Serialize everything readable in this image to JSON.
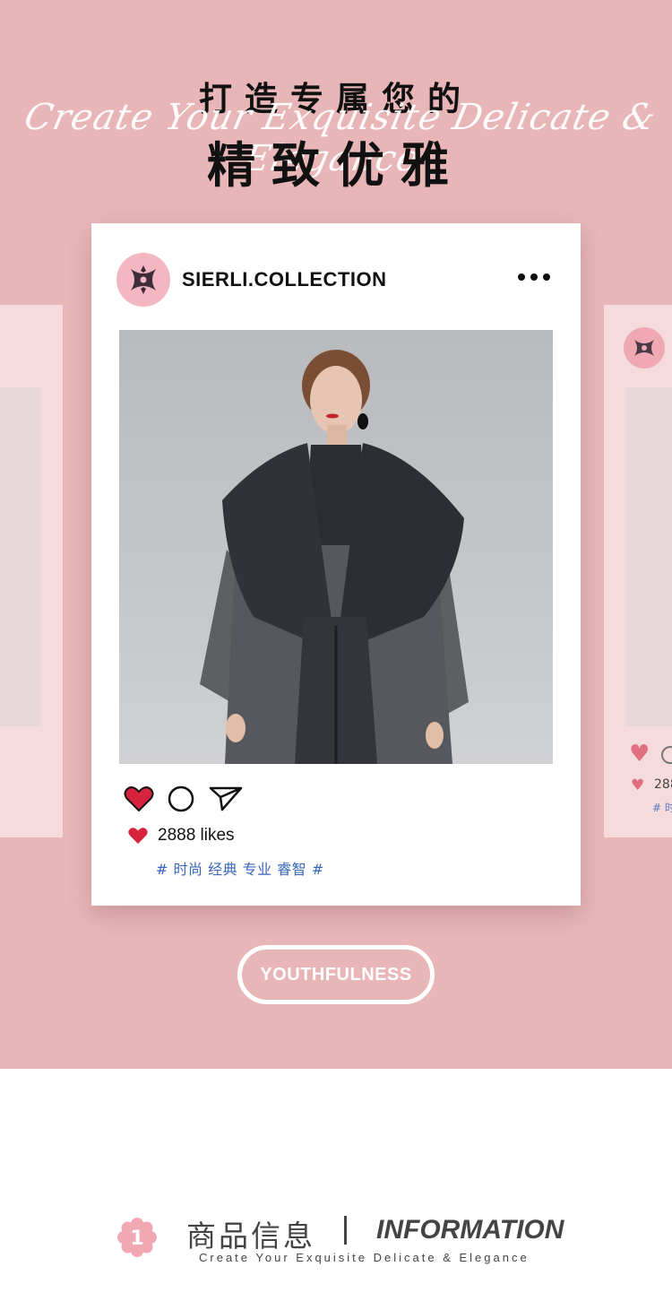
{
  "hero": {
    "headline_line1": "打造专属您的",
    "headline_script": "Create Your Exquisite Delicate & Elegance",
    "headline_line2": "精致优雅",
    "background_color": "#e8b6b7"
  },
  "post": {
    "username": "SIERLI.COLLECTION",
    "likes_text": "2888 likes",
    "hashtags": "# 时尚 经典 专业 睿智 #",
    "icons": [
      "more-dots-icon",
      "heart-icon",
      "comment-icon",
      "share-icon"
    ]
  },
  "ghost_card": {
    "likes_text": "288",
    "hashtag_text": "# 时"
  },
  "tag_button": {
    "label": "YOUTHFULNESS"
  },
  "info": {
    "badge_number": "1",
    "title_cn": "商品信息",
    "title_en": "INFORMATION",
    "subtitle": "Create Your Exquisite Delicate & Elegance"
  }
}
